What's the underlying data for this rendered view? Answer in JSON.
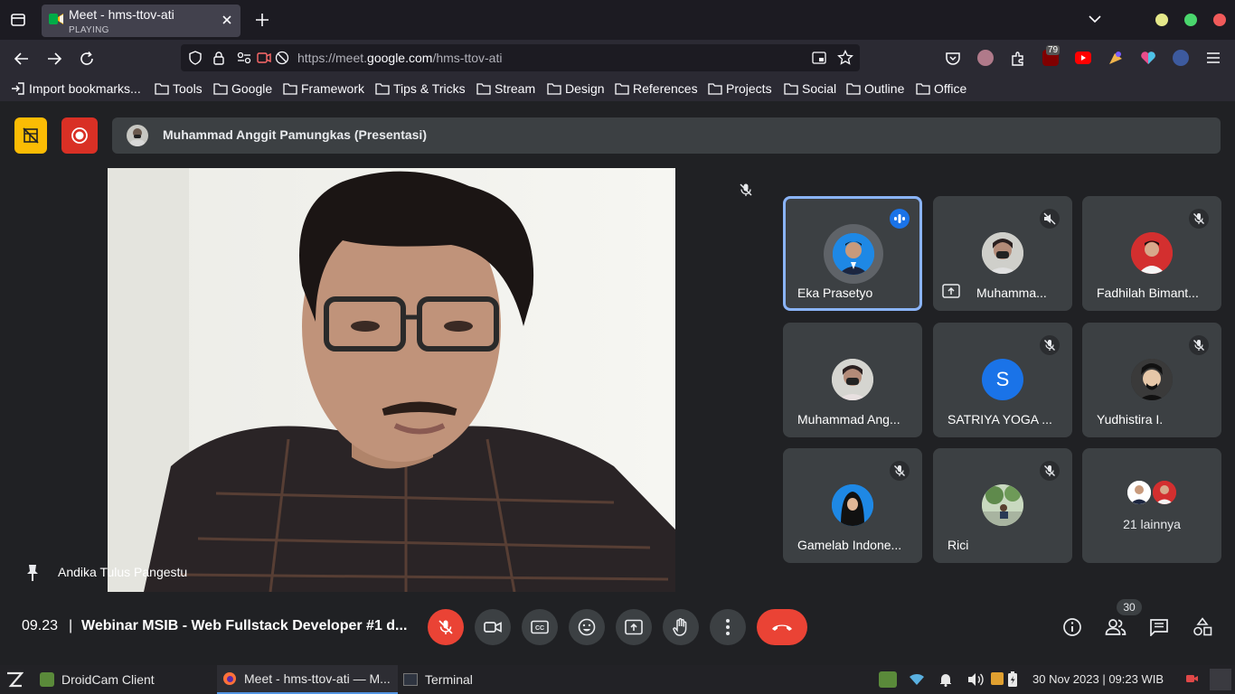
{
  "browser": {
    "tab": {
      "title": "Meet - hms-ttov-ati",
      "status": "PLAYING"
    },
    "url": {
      "prefix": "https://meet.",
      "domain": "google.com",
      "path": "/hms-ttov-ati"
    },
    "extension_badge": "79",
    "bookmarks": [
      {
        "label": "Import bookmarks..."
      },
      {
        "label": "Tools"
      },
      {
        "label": "Google"
      },
      {
        "label": "Framework"
      },
      {
        "label": "Tips & Tricks"
      },
      {
        "label": "Stream"
      },
      {
        "label": "Design"
      },
      {
        "label": "References"
      },
      {
        "label": "Projects"
      },
      {
        "label": "Social"
      },
      {
        "label": "Outline"
      },
      {
        "label": "Office"
      }
    ]
  },
  "meet": {
    "presenter_label": "Muhammad Anggit Pamungkas (Presentasi)",
    "main_participant": "Andika Tulus Pangestu",
    "tiles": [
      {
        "name": "Eka Prasetyo",
        "status": "speaking"
      },
      {
        "name": "Muhamma...",
        "status": "muted"
      },
      {
        "name": "Fadhilah Bimant...",
        "status": "muted"
      },
      {
        "name": "Muhammad Ang...",
        "status": ""
      },
      {
        "name": "SATRIYA YOGA ...",
        "status": "muted",
        "initial": "S"
      },
      {
        "name": "Yudhistira I.",
        "status": "muted"
      },
      {
        "name": "Gamelab Indone...",
        "status": "muted"
      },
      {
        "name": "Rici",
        "status": "muted"
      },
      {
        "name": "21 lainnya",
        "status": ""
      }
    ],
    "time": "09.23",
    "separator": "|",
    "meeting_title": "Webinar MSIB - Web Fullstack Developer #1 d...",
    "participant_count": "30"
  },
  "taskbar": {
    "items": [
      {
        "label": "DroidCam Client"
      },
      {
        "label": "Meet - hms-ttov-ati — M..."
      },
      {
        "label": "Terminal"
      }
    ],
    "datetime": "30 Nov 2023 | 09:23 WIB"
  },
  "colors": {
    "accent": "#8ab4f8",
    "danger": "#ea4335",
    "warning": "#fbbc04",
    "surface": "#3c4043"
  }
}
